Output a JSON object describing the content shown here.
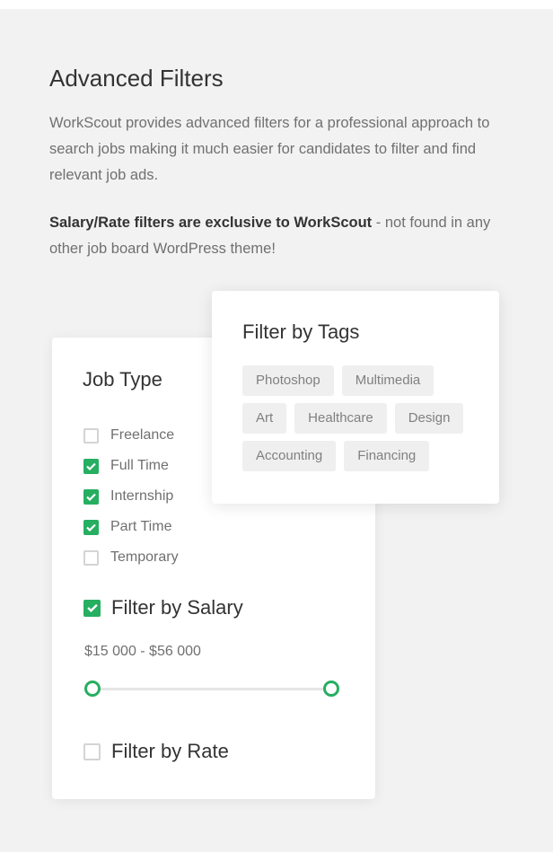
{
  "section": {
    "title": "Advanced Filters",
    "description": "WorkScout provides advanced filters for a professional approach to search jobs making it much easier for candidates to filter and find relevant job ads.",
    "note_bold": "Salary/Rate filters are exclusive to WorkScout",
    "note_rest": " - not found in any other job board WordPress theme!"
  },
  "job_type": {
    "title": "Job Type",
    "options": [
      {
        "label": "Freelance",
        "checked": false
      },
      {
        "label": "Full Time",
        "checked": true
      },
      {
        "label": "Internship",
        "checked": true
      },
      {
        "label": "Part Time",
        "checked": true
      },
      {
        "label": "Temporary",
        "checked": false
      }
    ],
    "salary_filter": {
      "label": "Filter by Salary",
      "checked": true
    },
    "salary_range": {
      "text": "$15 000 - $56 000",
      "min": 15000,
      "max": 56000,
      "low_fraction": 0.0,
      "high_fraction": 1.0
    },
    "rate_filter": {
      "label": "Filter by Rate",
      "checked": false
    }
  },
  "tags": {
    "title": "Filter by Tags",
    "rows": [
      [
        "Photoshop",
        "Multimedia"
      ],
      [
        "Art",
        "Healthcare",
        "Design"
      ],
      [
        "Accounting",
        "Financing"
      ]
    ]
  },
  "colors": {
    "accent": "#26ae61",
    "background": "#f2f2f2",
    "card": "#ffffff",
    "tag_bg": "#efefef",
    "heading": "#333333",
    "body_text": "#707070"
  }
}
